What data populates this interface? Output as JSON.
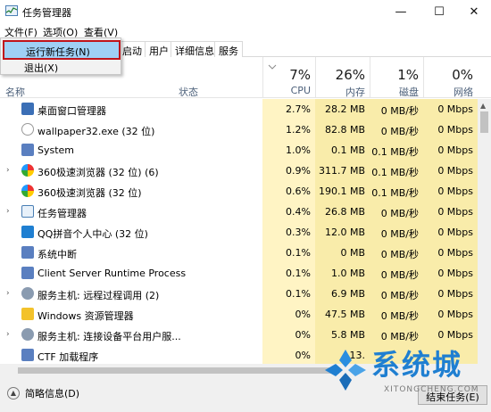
{
  "window": {
    "title": "任务管理器",
    "minimize": "—",
    "maximize": "☐",
    "close": "✕"
  },
  "menu": {
    "file": "文件(F)",
    "options": "选项(O)",
    "view": "查看(V)"
  },
  "tabs": [
    "启动",
    "用户",
    "详细信息",
    "服务"
  ],
  "file_menu": {
    "items": [
      "运行新任务(N)",
      "退出(X)"
    ],
    "highlighted_index": 0
  },
  "columns": {
    "name": "名称",
    "status": "状态",
    "cpu": {
      "pct": "7%",
      "label": "CPU"
    },
    "memory": {
      "pct": "26%",
      "label": "内存"
    },
    "disk": {
      "pct": "1%",
      "label": "磁盘"
    },
    "network": {
      "pct": "0%",
      "label": "网络"
    }
  },
  "rows": [
    {
      "name": "桌面窗口管理器",
      "expandable": false,
      "icon": "desktop-window-manager-icon",
      "cpu": "2.7%",
      "mem": "28.2 MB",
      "disk": "0 MB/秒",
      "net": "0 Mbps"
    },
    {
      "name": "wallpaper32.exe (32 位)",
      "expandable": false,
      "icon": "wallpaper-icon",
      "cpu": "1.2%",
      "mem": "82.8 MB",
      "disk": "0 MB/秒",
      "net": "0 Mbps"
    },
    {
      "name": "System",
      "expandable": false,
      "icon": "system-icon",
      "cpu": "1.0%",
      "mem": "0.1 MB",
      "disk": "0.1 MB/秒",
      "net": "0 Mbps"
    },
    {
      "name": "360极速浏览器 (32 位) (6)",
      "expandable": true,
      "icon": "360-browser-icon",
      "cpu": "0.9%",
      "mem": "311.7 MB",
      "disk": "0.1 MB/秒",
      "net": "0 Mbps"
    },
    {
      "name": "360极速浏览器 (32 位)",
      "expandable": false,
      "icon": "360-browser-icon",
      "cpu": "0.6%",
      "mem": "190.1 MB",
      "disk": "0.1 MB/秒",
      "net": "0 Mbps"
    },
    {
      "name": "任务管理器",
      "expandable": true,
      "icon": "task-manager-icon",
      "cpu": "0.4%",
      "mem": "26.8 MB",
      "disk": "0 MB/秒",
      "net": "0 Mbps"
    },
    {
      "name": "QQ拼音个人中心 (32 位)",
      "expandable": false,
      "icon": "qq-pinyin-icon",
      "cpu": "0.3%",
      "mem": "12.0 MB",
      "disk": "0 MB/秒",
      "net": "0 Mbps"
    },
    {
      "name": "系统中断",
      "expandable": false,
      "icon": "system-interrupts-icon",
      "cpu": "0.1%",
      "mem": "0 MB",
      "disk": "0 MB/秒",
      "net": "0 Mbps"
    },
    {
      "name": "Client Server Runtime Process",
      "expandable": false,
      "icon": "csrss-icon",
      "cpu": "0.1%",
      "mem": "1.0 MB",
      "disk": "0 MB/秒",
      "net": "0 Mbps"
    },
    {
      "name": "服务主机: 远程过程调用 (2)",
      "expandable": true,
      "icon": "service-host-icon",
      "cpu": "0.1%",
      "mem": "6.9 MB",
      "disk": "0 MB/秒",
      "net": "0 Mbps"
    },
    {
      "name": "Windows 资源管理器",
      "expandable": false,
      "icon": "explorer-icon",
      "cpu": "0%",
      "mem": "47.5 MB",
      "disk": "0 MB/秒",
      "net": "0 Mbps"
    },
    {
      "name": "服务主机: 连接设备平台用户服...",
      "expandable": true,
      "icon": "service-host-icon",
      "cpu": "0%",
      "mem": "5.8 MB",
      "disk": "0 MB/秒",
      "net": "0 Mbps"
    },
    {
      "name": "CTF 加载程序",
      "expandable": false,
      "icon": "ctf-loader-icon",
      "cpu": "0%",
      "mem": "13.",
      "disk": "",
      "net": ""
    }
  ],
  "footer": {
    "less_info": "简略信息(D)",
    "end_task": "结束任务(E)"
  },
  "watermark": {
    "text": "系统城",
    "sub": "XITONGCHENG.COM"
  },
  "colors": {
    "highlight": "#9fd0f5",
    "highlight_border": "#c0141b",
    "heat_cpu": "#fff4c4",
    "heat_col": "#f9ecaa",
    "watermark_blue": "#1f7fd1"
  }
}
